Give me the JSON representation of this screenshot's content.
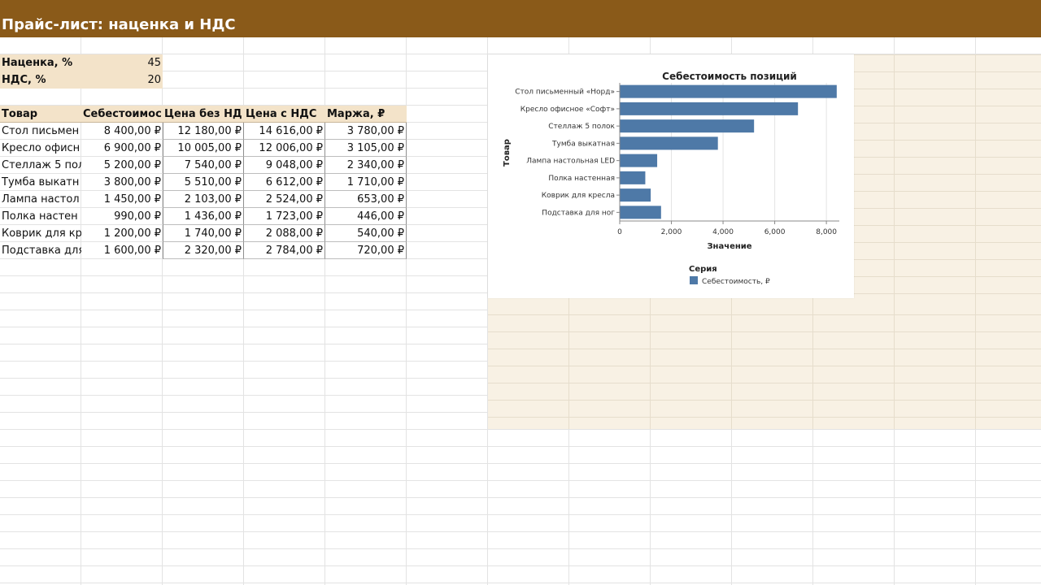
{
  "sheet_title": "Прайс-лист: наценка и НДС",
  "params": [
    {
      "label": "Наценка, %",
      "value": "45"
    },
    {
      "label": "НДС, %",
      "value": "20"
    }
  ],
  "table": {
    "headers": [
      "Товар",
      "Себестоимос",
      "Цена без НД",
      "Цена с НДС",
      "Маржа, ₽"
    ],
    "rows": [
      [
        "Стол письмен",
        "8 400,00 ₽",
        "12 180,00 ₽",
        "14 616,00 ₽",
        "3 780,00 ₽"
      ],
      [
        "Кресло офисн",
        "6 900,00 ₽",
        "10 005,00 ₽",
        "12 006,00 ₽",
        "3 105,00 ₽"
      ],
      [
        "Стеллаж 5 пол",
        "5 200,00 ₽",
        "7 540,00 ₽",
        "9 048,00 ₽",
        "2 340,00 ₽"
      ],
      [
        "Тумба выкатн",
        "3 800,00 ₽",
        "5 510,00 ₽",
        "6 612,00 ₽",
        "1 710,00 ₽"
      ],
      [
        "Лампа настол",
        "1 450,00 ₽",
        "2 103,00 ₽",
        "2 524,00 ₽",
        "653,00 ₽"
      ],
      [
        "Полка настен",
        "990,00 ₽",
        "1 436,00 ₽",
        "1 723,00 ₽",
        "446,00 ₽"
      ],
      [
        "Коврик для кр",
        "1 200,00 ₽",
        "1 740,00 ₽",
        "2 088,00 ₽",
        "540,00 ₽"
      ],
      [
        "Подставка для",
        "1 600,00 ₽",
        "2 320,00 ₽",
        "2 784,00 ₽",
        "720,00 ₽"
      ]
    ]
  },
  "chart_data": {
    "type": "bar",
    "orientation": "horizontal",
    "title": "Себестоимость позиций",
    "xlabel": "Значение",
    "ylabel": "Товар",
    "categories": [
      "Стол письменный «Норд»",
      "Кресло офисное «Софт»",
      "Стеллаж 5 полок",
      "Тумба выкатная",
      "Лампа настольная LED",
      "Полка настенная",
      "Коврик для кресла",
      "Подставка для ног"
    ],
    "series": [
      {
        "name": "Себестоимость, ₽",
        "values": [
          8400,
          6900,
          5200,
          3800,
          1450,
          990,
          1200,
          1600
        ],
        "color": "#4e79a7"
      }
    ],
    "xlim": [
      0,
      8500
    ],
    "xticks": [
      0,
      2000,
      4000,
      6000,
      8000
    ],
    "xtick_labels": [
      "0",
      "2,000",
      "4,000",
      "6,000",
      "8,000"
    ],
    "grid": true,
    "legend_title": "Серия",
    "legend_position": "bottom"
  }
}
